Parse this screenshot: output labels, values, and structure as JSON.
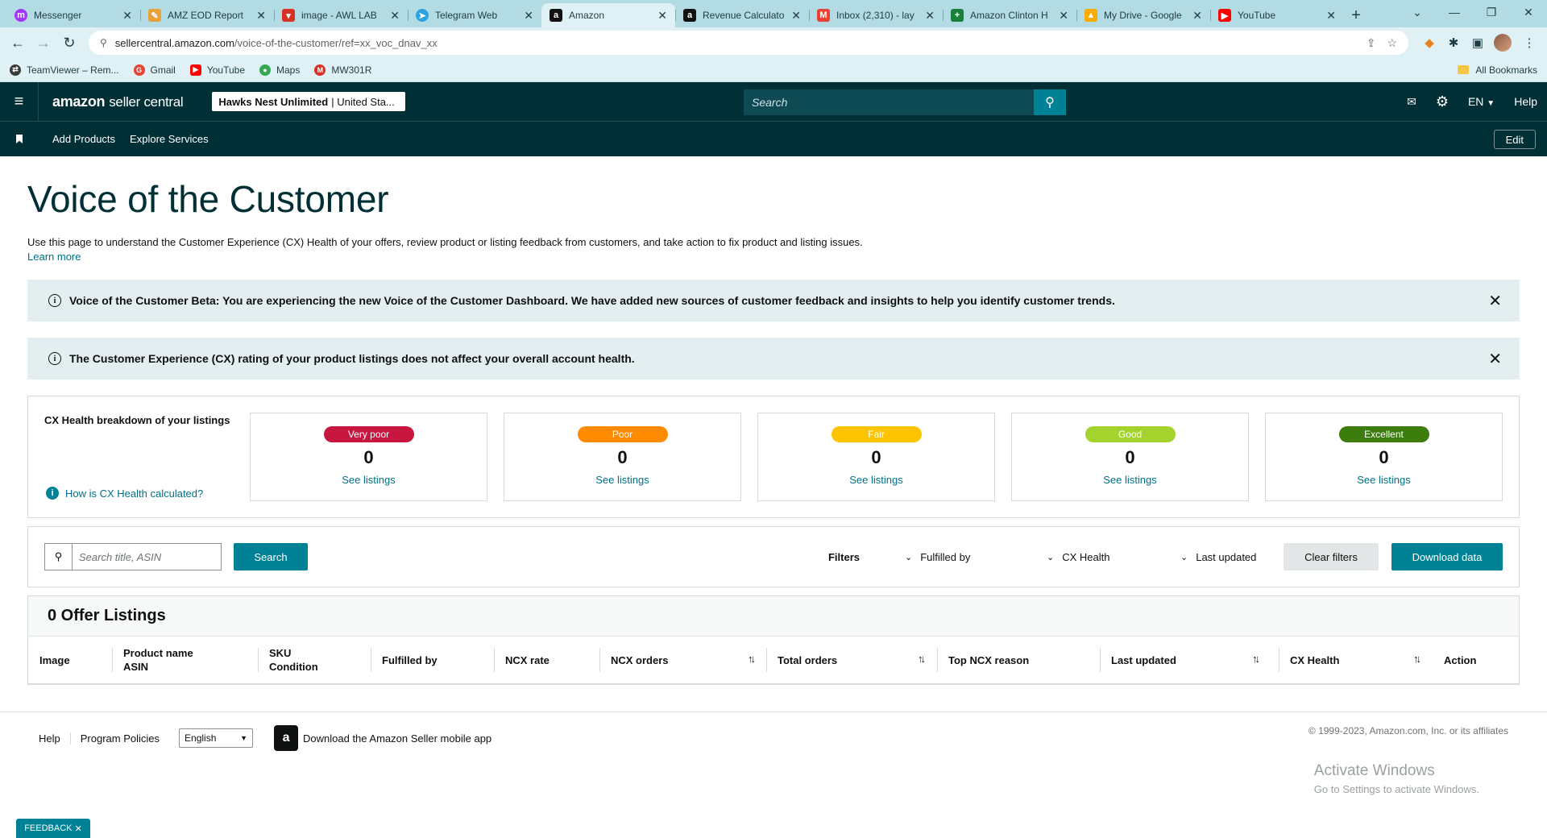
{
  "browser": {
    "tabs": [
      {
        "label": "Messenger",
        "icon": "messenger-icon",
        "color": "#a334fa"
      },
      {
        "label": "AMZ EOD Report",
        "icon": "pencil-icon",
        "color": "#e8a13b"
      },
      {
        "label": "image - AWL LAB",
        "icon": "vlab-icon",
        "color": "#d93025"
      },
      {
        "label": "Telegram Web",
        "icon": "telegram-icon",
        "color": "#2aa3e0"
      },
      {
        "label": "Amazon",
        "icon": "amazon-icon",
        "color": "#111111"
      },
      {
        "label": "Revenue Calculato",
        "icon": "amazon-icon",
        "color": "#111111"
      },
      {
        "label": "Inbox (2,310) - lay",
        "icon": "gmail-icon",
        "color": "#ea4335"
      },
      {
        "label": "Amazon Clinton H",
        "icon": "sheets-icon",
        "color": "#188038"
      },
      {
        "label": "My Drive - Google",
        "icon": "drive-icon",
        "color": "#f9ab00"
      },
      {
        "label": "YouTube",
        "icon": "youtube-icon",
        "color": "#ff0000"
      }
    ],
    "url_host": "sellercentral.amazon.com",
    "url_path": "/voice-of-the-customer/ref=xx_voc_dnav_xx",
    "bookmarks": [
      {
        "label": "TeamViewer – Rem...",
        "color": "#3a3a3a"
      },
      {
        "label": "Gmail",
        "color": "#ea4335"
      },
      {
        "label": "YouTube",
        "color": "#ff0000"
      },
      {
        "label": "Maps",
        "color": "#34a853"
      },
      {
        "label": "MW301R",
        "color": "#d93025"
      }
    ],
    "all_bookmarks": "All Bookmarks"
  },
  "header": {
    "logo_brand": "amazon",
    "logo_suffix": "seller central",
    "store_name": "Hawks Nest Unlimited",
    "store_market": "| United Sta...",
    "search_placeholder": "Search",
    "lang": "EN",
    "help": "Help"
  },
  "subnav": {
    "items": [
      "Add Products",
      "Explore Services"
    ],
    "edit": "Edit"
  },
  "page": {
    "title": "Voice of the Customer",
    "intro": "Use this page to understand the Customer Experience (CX) Health of your offers, review product or listing feedback from customers, and take action to fix product and listing issues.",
    "learn_more": "Learn more",
    "alerts": [
      "Voice of the Customer Beta: You are experiencing the new Voice of the Customer Dashboard. We have added new sources of customer feedback and insights to help you identify customer trends.",
      "The Customer Experience (CX) rating of your product listings does not affect your overall account health."
    ]
  },
  "cx_health": {
    "title": "CX Health breakdown of your listings",
    "how_link": "How is CX Health calculated?",
    "cards": [
      {
        "label": "Very poor",
        "count": "0",
        "link": "See listings",
        "color": "#c7163f"
      },
      {
        "label": "Poor",
        "count": "0",
        "link": "See listings",
        "color": "#ff8c00"
      },
      {
        "label": "Fair",
        "count": "0",
        "link": "See listings",
        "color": "#ffc400"
      },
      {
        "label": "Good",
        "count": "0",
        "link": "See listings",
        "color": "#a4d32e"
      },
      {
        "label": "Excellent",
        "count": "0",
        "link": "See listings",
        "color": "#3c7d0e"
      }
    ]
  },
  "filters": {
    "search_placeholder": "Search title, ASIN",
    "search_button": "Search",
    "label": "Filters",
    "dropdowns": [
      "Fulfilled by",
      "CX Health",
      "Last updated"
    ],
    "clear": "Clear filters",
    "download": "Download data"
  },
  "listings": {
    "title": "0 Offer Listings",
    "columns": [
      {
        "line1": "Image",
        "line2": ""
      },
      {
        "line1": "Product name",
        "line2": "ASIN"
      },
      {
        "line1": "SKU",
        "line2": "Condition"
      },
      {
        "line1": "Fulfilled by",
        "line2": ""
      },
      {
        "line1": "NCX rate",
        "line2": ""
      },
      {
        "line1": "NCX orders",
        "line2": ""
      },
      {
        "line1": "Total orders",
        "line2": ""
      },
      {
        "line1": "Top NCX reason",
        "line2": ""
      },
      {
        "line1": "Last updated",
        "line2": ""
      },
      {
        "line1": "CX Health",
        "line2": ""
      },
      {
        "line1": "Action",
        "line2": ""
      }
    ]
  },
  "footer": {
    "links": [
      "Help",
      "Program Policies"
    ],
    "language": "English",
    "app_link": "Download the Amazon Seller mobile app",
    "copyright": "© 1999-2023, Amazon.com, Inc. or its affiliates",
    "activate_title": "Activate Windows",
    "activate_sub": "Go to Settings to activate Windows.",
    "feedback": "FEEDBACK"
  }
}
